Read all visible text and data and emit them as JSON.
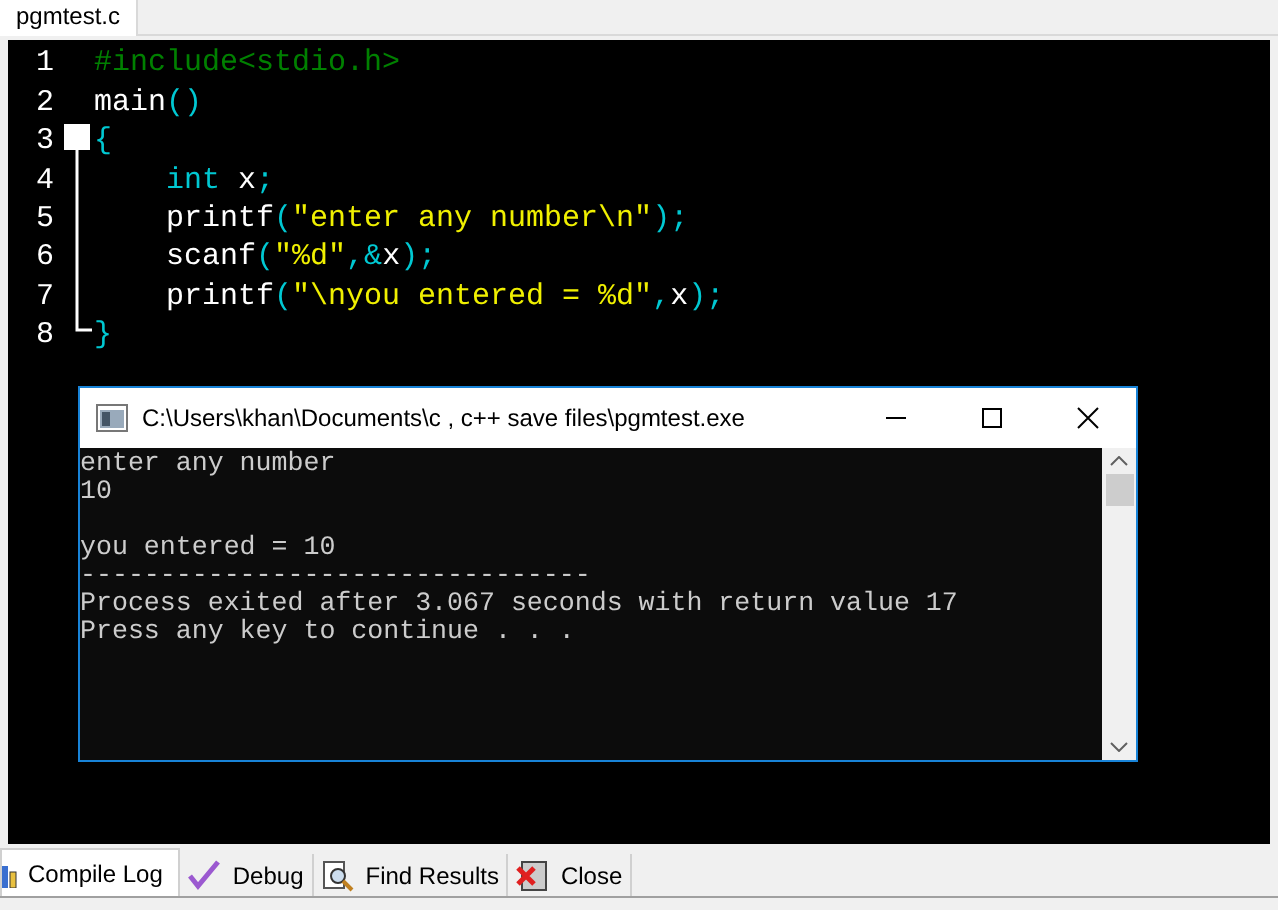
{
  "editor_tabs": [
    {
      "label": "pgmtest.c",
      "selected": true
    }
  ],
  "code_lines": [
    {
      "number": "1",
      "tokens": [
        {
          "kind": "preprocessor",
          "text": "#include<stdio.h>"
        }
      ]
    },
    {
      "number": "2",
      "tokens": [
        {
          "kind": "identifier",
          "text": "main"
        },
        {
          "kind": "punct",
          "text": "()"
        }
      ]
    },
    {
      "number": "3",
      "tokens": [
        {
          "kind": "punct",
          "text": "{"
        }
      ],
      "children": [
        {
          "number": "4",
          "tokens": [
            {
              "kind": "keyword",
              "text": "int"
            },
            {
              "kind": "identifier",
              "text": " x"
            },
            {
              "kind": "punct",
              "text": ";"
            }
          ]
        },
        {
          "number": "5",
          "tokens": [
            {
              "kind": "identifier",
              "text": "printf"
            },
            {
              "kind": "punct",
              "text": "("
            },
            {
              "kind": "string",
              "text": "\"enter any number\\n\""
            },
            {
              "kind": "punct",
              "text": ");"
            }
          ]
        },
        {
          "number": "6",
          "tokens": [
            {
              "kind": "identifier",
              "text": "scanf"
            },
            {
              "kind": "punct",
              "text": "("
            },
            {
              "kind": "string",
              "text": "\"%d\""
            },
            {
              "kind": "punct",
              "text": ",&"
            },
            {
              "kind": "identifier",
              "text": "x"
            },
            {
              "kind": "punct",
              "text": ");"
            }
          ]
        },
        {
          "number": "7",
          "tokens": [
            {
              "kind": "identifier",
              "text": "printf"
            },
            {
              "kind": "punct",
              "text": "("
            },
            {
              "kind": "string",
              "text": "\"\\nyou entered = %d\""
            },
            {
              "kind": "punct",
              "text": ","
            },
            {
              "kind": "identifier",
              "text": "x"
            },
            {
              "kind": "punct",
              "text": ");"
            }
          ]
        }
      ]
    },
    {
      "number": "8",
      "tokens": [
        {
          "kind": "punct",
          "text": "}"
        }
      ]
    }
  ],
  "console_window": {
    "title": "C:\\Users\\khan\\Documents\\c , c++ save files\\pgmtest.exe",
    "paragraphs": [
      [
        "enter any number",
        "10"
      ],
      [
        "you entered = 10",
        "--------------------------------",
        "Process exited after 3.067 seconds with return value 17",
        "Press any key to continue . . ."
      ]
    ]
  },
  "bottom_tabs": [
    {
      "label": "Compile Log",
      "kind": "compile",
      "selected": true
    },
    {
      "label": "Debug",
      "kind": "debug",
      "selected": false
    },
    {
      "label": "Find Results",
      "kind": "find",
      "selected": false
    },
    {
      "label": "Close",
      "kind": "close",
      "selected": false
    }
  ]
}
